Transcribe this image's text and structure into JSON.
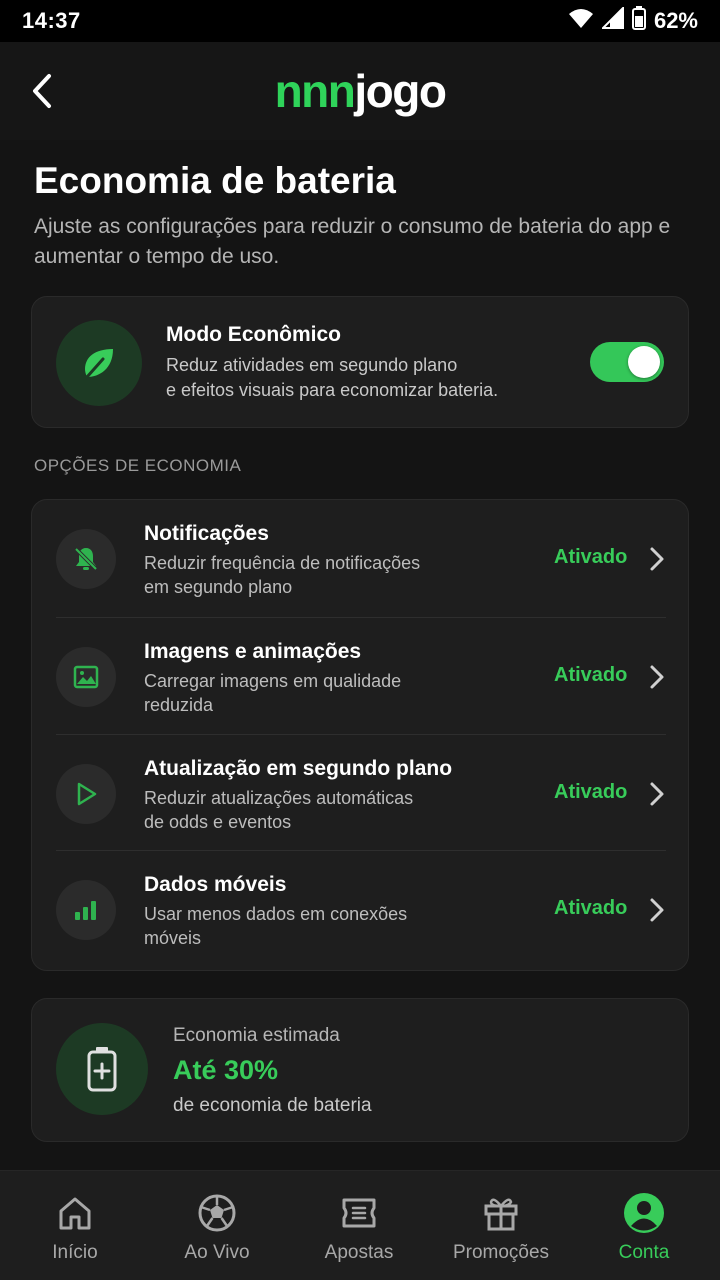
{
  "status_bar": {
    "time": "14:37",
    "battery": "62%"
  },
  "header": {
    "logo_part1": "nnn",
    "logo_part2": "jogo"
  },
  "page": {
    "title": "Economia de bateria",
    "subtitle": "Ajuste as configurações para reduzir o consumo de bateria do app e aumentar o tempo de uso."
  },
  "eco_mode": {
    "title": "Modo Econômico",
    "description_line1": "Reduz atividades em segundo plano",
    "description_line2": "e efeitos visuais para economizar bateria.",
    "enabled": true
  },
  "options_section": {
    "label": "OPÇÕES DE ECONOMIA",
    "items": [
      {
        "icon": "bell-off-icon",
        "title": "Notificações",
        "desc_line1": "Reduzir frequência de notificações",
        "desc_line2": "em segundo plano",
        "status": "Ativado"
      },
      {
        "icon": "image-icon",
        "title": "Imagens e animações",
        "desc_line1": "Carregar imagens em qualidade",
        "desc_line2": "reduzida",
        "status": "Ativado"
      },
      {
        "icon": "play-icon",
        "title": "Atualização em segundo plano",
        "desc_line1": "Reduzir atualizações automáticas",
        "desc_line2": "de odds e eventos",
        "status": "Ativado"
      },
      {
        "icon": "signal-bars-icon",
        "title": "Dados móveis",
        "desc_line1": "Usar menos dados em conexões",
        "desc_line2": "móveis",
        "status": "Ativado"
      }
    ]
  },
  "estimate": {
    "label": "Economia estimada",
    "value": "Até 30%",
    "sub": "de economia de bateria"
  },
  "bottom_nav": {
    "items": [
      {
        "icon": "home-icon",
        "label": "Início"
      },
      {
        "icon": "soccer-ball-icon",
        "label": "Ao Vivo"
      },
      {
        "icon": "ticket-icon",
        "label": "Apostas"
      },
      {
        "icon": "gift-icon",
        "label": "Promoções"
      },
      {
        "icon": "user-icon",
        "label": "Conta"
      }
    ],
    "active_index": 4
  },
  "colors": {
    "accent": "#38cc5a",
    "background": "#141414",
    "card": "#1e1e1e",
    "toggle_on": "#34c759"
  }
}
